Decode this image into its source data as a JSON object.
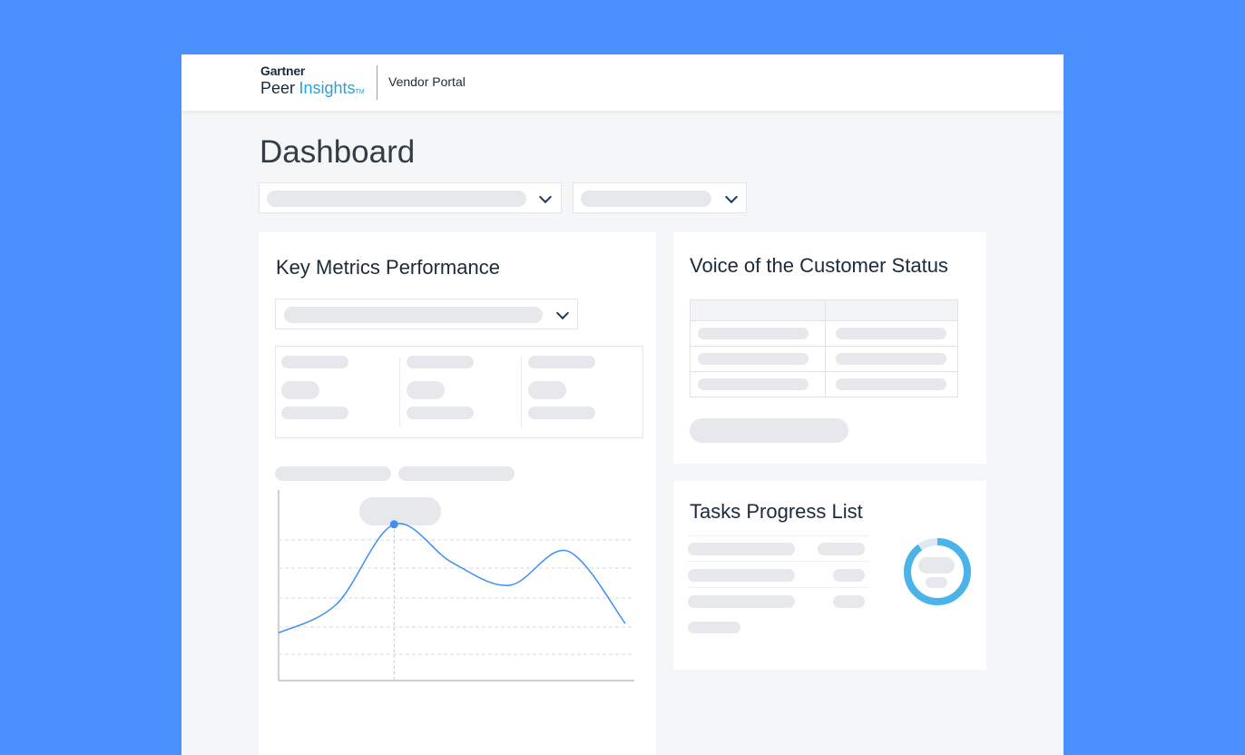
{
  "header": {
    "brand_top": "Gartner",
    "brand_peer": "Peer",
    "brand_insights": "Insights",
    "brand_tm": "TM",
    "portal_label": "Vendor Portal"
  },
  "page": {
    "title": "Dashboard"
  },
  "cards": {
    "key_metrics": {
      "title": "Key Metrics Performance"
    },
    "voice_of_customer": {
      "title": "Voice of the Customer Status"
    },
    "tasks": {
      "title": "Tasks Progress List"
    }
  },
  "colors": {
    "background": "#4a90ff",
    "chart_line": "#3d8ff0",
    "donut": "#4ab3e8",
    "placeholder": "#e6e8eb"
  },
  "chart_data": {
    "type": "line",
    "title": "",
    "xlabel": "",
    "ylabel": "",
    "grid": true,
    "x": [
      0,
      1,
      2,
      3,
      4,
      5,
      6
    ],
    "series": [
      {
        "values": [
          0.25,
          0.4,
          0.82,
          0.62,
          0.5,
          0.68,
          0.3
        ]
      }
    ],
    "highlight_index": 2
  },
  "tasks_progress": {
    "donut_fraction": 0.9
  }
}
